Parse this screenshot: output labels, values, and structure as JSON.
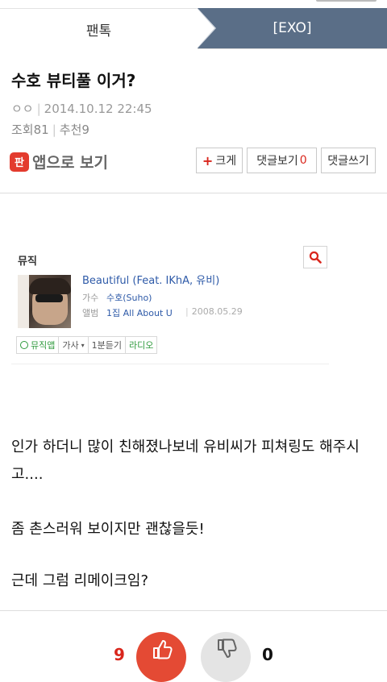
{
  "breadcrumb": {
    "left": "팬톡",
    "right": "[EXO]"
  },
  "post": {
    "title": "수호 뷰티풀 이거?",
    "author": "ㅇㅇ",
    "datetime": "2014.10.12 22:45",
    "views_label": "조회",
    "views": "81",
    "recommend_label": "추천",
    "recommend": "9"
  },
  "actions": {
    "app_icon_text": "판",
    "app_label": "앱으로 보기",
    "zoom_plus": "+",
    "zoom_label": "크게",
    "view_comments_label": "댓글보기",
    "comment_count": "0",
    "write_comment_label": "댓글쓰기"
  },
  "music": {
    "heading": "뮤직",
    "song": "Beautiful (Feat. IKhA, 유비)",
    "singer_label": "가수",
    "singer": "수호(Suho)",
    "album_label": "앨범",
    "album": "1집 All About U",
    "album_date": "2008.05.29",
    "chips": [
      "뮤직앱",
      "가사",
      "1분듣기",
      "라디오"
    ]
  },
  "body": {
    "p1": "인가 하더니 많이 친해졌나보네 유비씨가 피쳐링도 해주시고....",
    "p2": "좀 촌스러워 보이지만 괜찮을듯!",
    "p3": "근데 그럼 리메이크임?"
  },
  "votes": {
    "up": "9",
    "down": "0"
  },
  "colors": {
    "accent_red": "#d9261c",
    "breadcrumb_active": "#5a6e87",
    "link_blue": "#2e5aa8"
  }
}
